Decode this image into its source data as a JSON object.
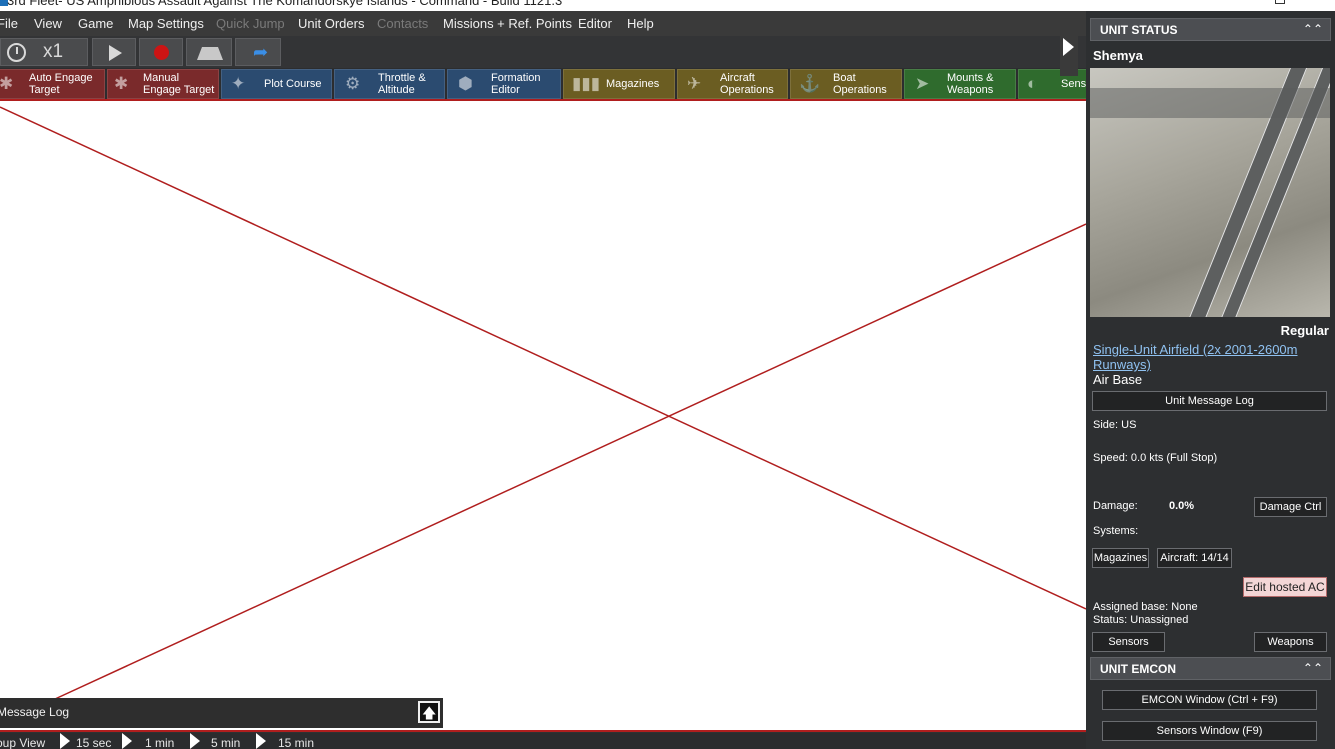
{
  "window": {
    "title": "3rd Fleet- US Amphibious Assault Against The Komandorskye Islands - Command - Build 1121.3"
  },
  "menu": [
    {
      "label": "File",
      "enabled": true
    },
    {
      "label": "View",
      "enabled": true
    },
    {
      "label": "Game",
      "enabled": true
    },
    {
      "label": "Map Settings",
      "enabled": true
    },
    {
      "label": "Quick Jump",
      "enabled": false
    },
    {
      "label": "Unit Orders",
      "enabled": true
    },
    {
      "label": "Contacts",
      "enabled": false
    },
    {
      "label": "Missions + Ref. Points",
      "enabled": true
    },
    {
      "label": "Editor",
      "enabled": true
    },
    {
      "label": "Help",
      "enabled": true
    }
  ],
  "toolbar": {
    "speed": "x1"
  },
  "orders": [
    {
      "line1": "Auto Engage",
      "line2": "Target",
      "icon": "gear-icon",
      "color": "red"
    },
    {
      "line1": "Manual",
      "line2": "Engage Target",
      "icon": "gear-icon",
      "color": "red"
    },
    {
      "line1": "Plot Course",
      "line2": "",
      "icon": "compass-icon",
      "color": "blue"
    },
    {
      "line1": "Throttle &",
      "line2": "Altitude",
      "icon": "throttle-icon",
      "color": "blue"
    },
    {
      "line1": "Formation",
      "line2": "Editor",
      "icon": "formation-icon",
      "color": "blue"
    },
    {
      "line1": "Magazines",
      "line2": "",
      "icon": "ammo-icon",
      "color": "olive"
    },
    {
      "line1": "Aircraft",
      "line2": "Operations",
      "icon": "aircraft-icon",
      "color": "olive"
    },
    {
      "line1": "Boat",
      "line2": "Operations",
      "icon": "boat-icon",
      "color": "olive"
    },
    {
      "line1": "Mounts &",
      "line2": "Weapons",
      "icon": "missile-icon",
      "color": "green"
    },
    {
      "line1": "Sens",
      "line2": "",
      "icon": "radar-icon",
      "color": "green"
    }
  ],
  "message_log": {
    "title": "Message Log"
  },
  "time_bar": {
    "group_view": "oup View",
    "steps": [
      "15 sec",
      "1 min",
      "5 min",
      "15 min"
    ]
  },
  "unit_status": {
    "header": "UNIT STATUS",
    "unit_name": "Shemya",
    "proficiency": "Regular",
    "unit_class": "Single-Unit Airfield (2x 2001-2600m Runways)",
    "unit_type": "Air Base",
    "message_log_button": "Unit Message Log",
    "side": "Side: US",
    "speed": "Speed: 0.0 kts (Full Stop)",
    "damage_label": "Damage:",
    "damage_value": "0.0%",
    "damage_ctrl_button": "Damage Ctrl",
    "systems_label": "Systems:",
    "magazines_button": "Magazines",
    "aircraft_button": "Aircraft: 14/14",
    "edit_hosted_button": "Edit hosted AC",
    "assigned_base": "Assigned base: None",
    "status": "Status: Unassigned",
    "sensors_button": "Sensors",
    "weapons_button": "Weapons"
  },
  "unit_emcon": {
    "header": "UNIT EMCON",
    "emcon_button": "EMCON Window (Ctrl + F9)",
    "sensors_window_button": "Sensors Window (F9)"
  },
  "colors": {
    "map_line": "#b01e1e",
    "order_red": "#7a2a2b",
    "order_blue": "#2b4b70",
    "order_olive": "#6b5d22",
    "order_green": "#2f6b2d"
  }
}
